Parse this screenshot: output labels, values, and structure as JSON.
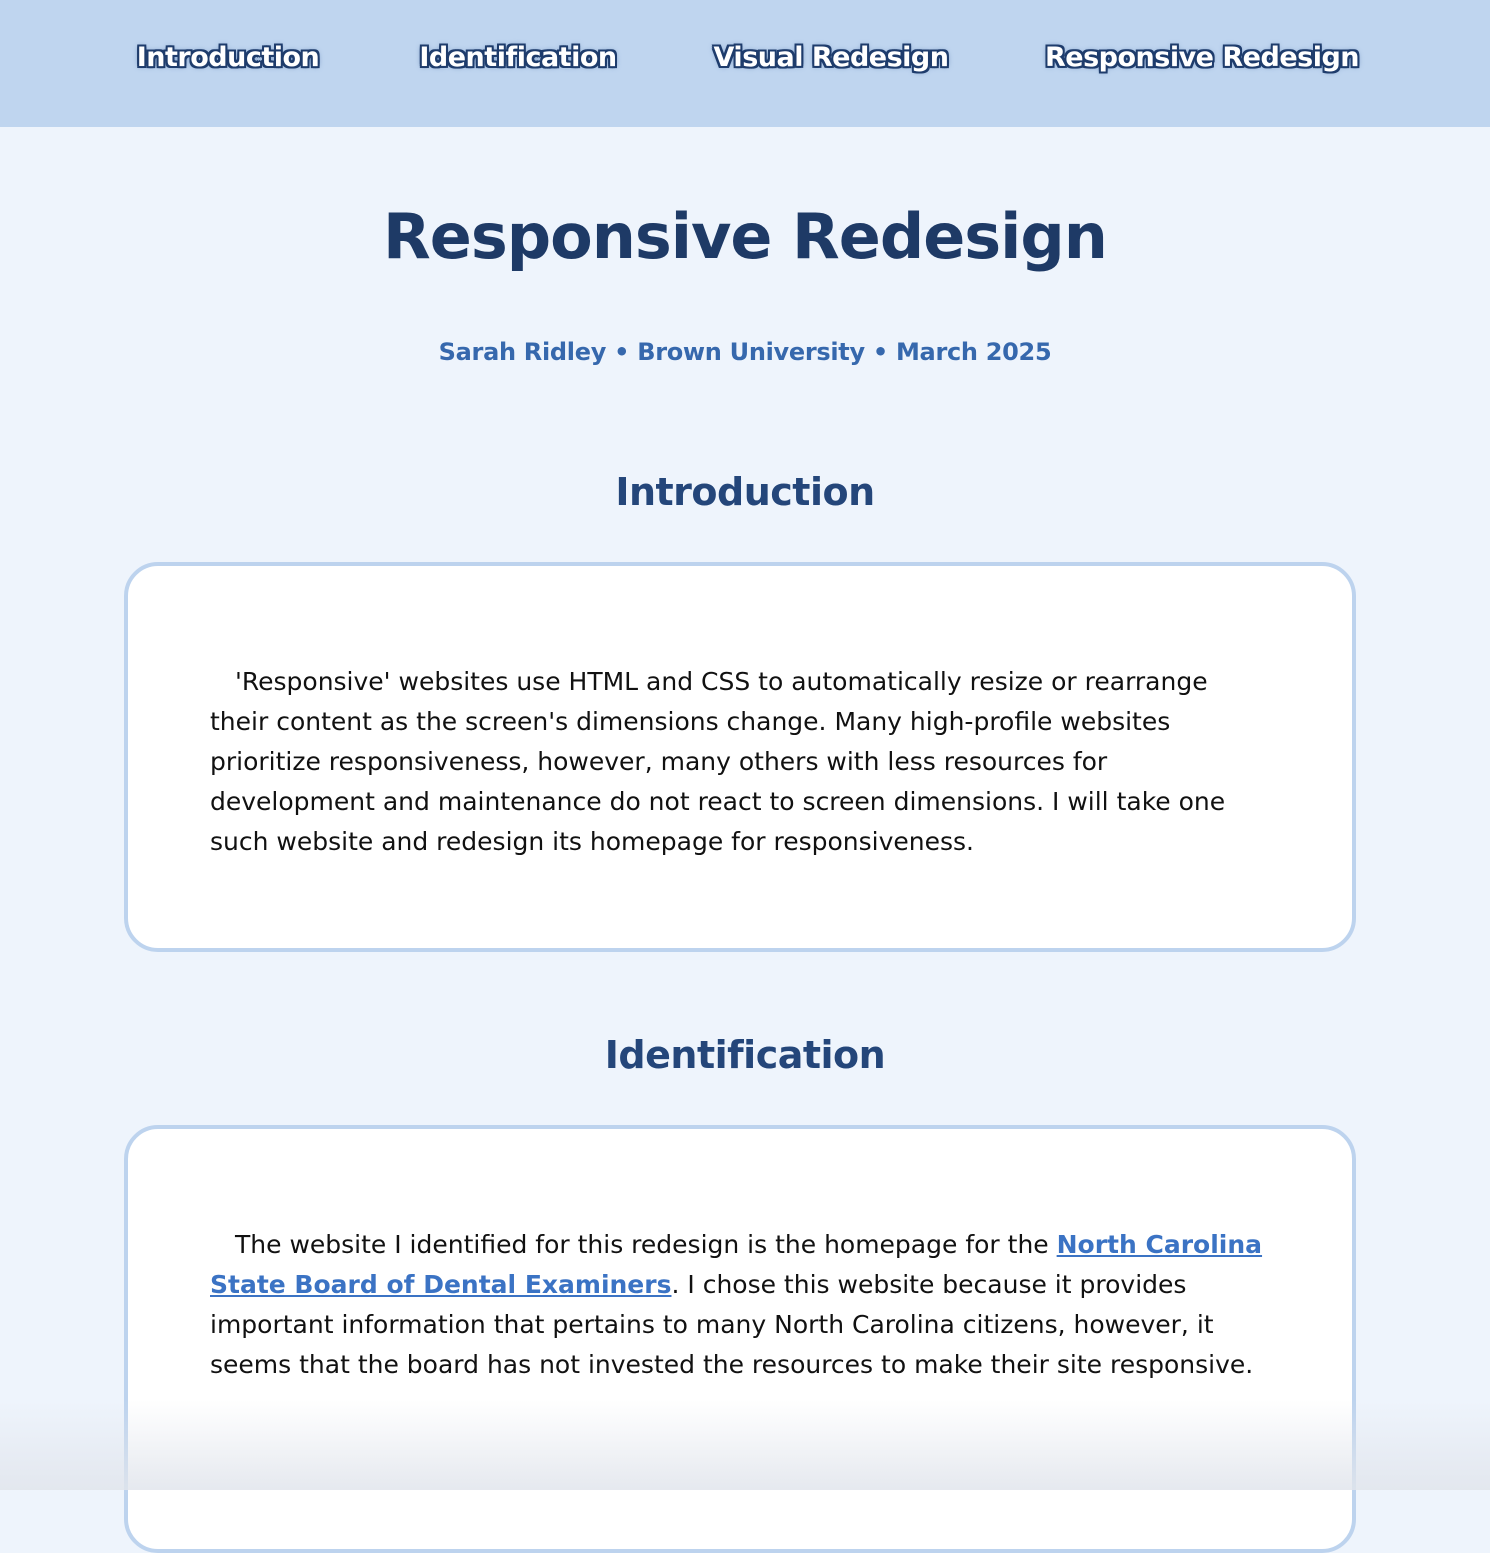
{
  "nav": {
    "items": [
      {
        "label": "Introduction"
      },
      {
        "label": "Identification"
      },
      {
        "label": "Visual Redesign"
      },
      {
        "label": "Responsive Redesign"
      }
    ]
  },
  "header": {
    "title": "Responsive Redesign",
    "byline": "Sarah Ridley • Brown University • March 2025"
  },
  "sections": {
    "introduction": {
      "heading": "Introduction",
      "body": "'Responsive' websites use HTML and CSS to automatically resize or rearrange their content as the screen's dimensions change. Many high-profile websites prioritize responsiveness, however, many others with less resources for development and maintenance do not react to screen dimensions. I will take one such website and redesign its homepage for responsiveness."
    },
    "identification": {
      "heading": "Identification",
      "body_before": "The website I identified for this redesign is the homepage for the ",
      "link_text": "North Carolina State Board of Dental Examiners",
      "body_after": ". I chose this website because it provides important information that pertains to many North Carolina citizens, however, it seems that the board has not invested the resources to make their site responsive."
    }
  },
  "colors": {
    "navbar": "#bfd5ef",
    "background": "#eef4fc",
    "title": "#1e3a66",
    "byline": "#3668ad",
    "link": "#3b73c4",
    "card_border": "#bdd3ee"
  }
}
